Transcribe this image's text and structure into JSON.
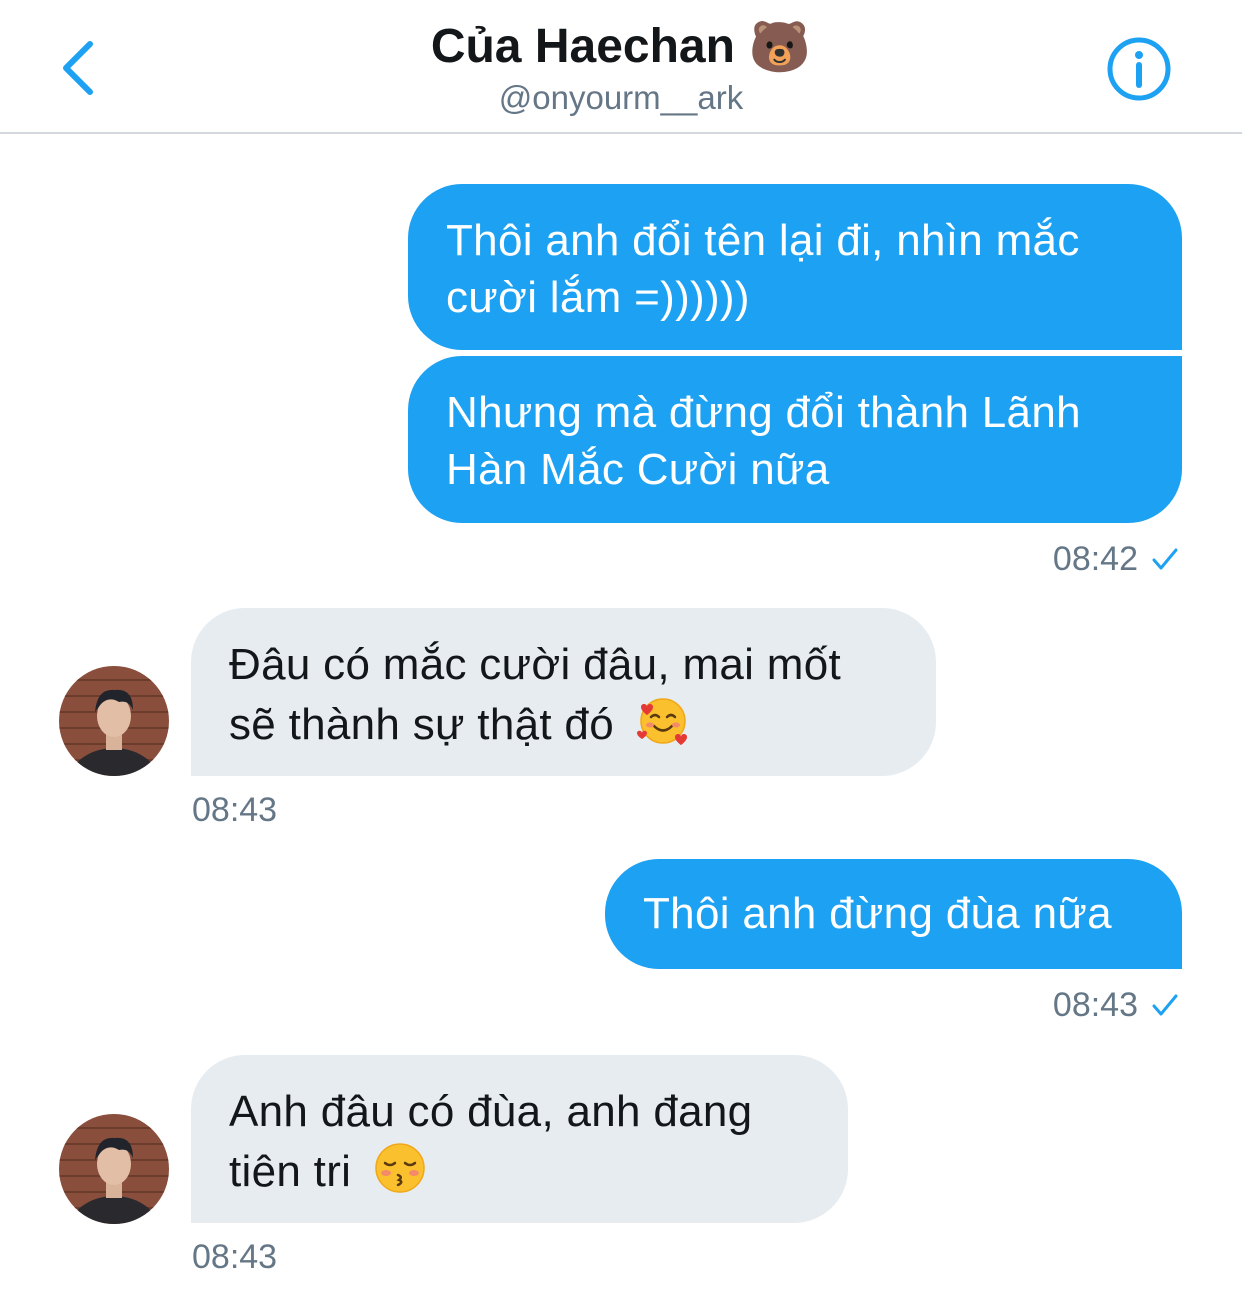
{
  "header": {
    "title": "Của Haechan",
    "title_emoji": "🐻",
    "handle": "@onyourm__ark"
  },
  "messages": [
    {
      "direction": "outgoing",
      "lines": [
        "Thôi anh đổi tên lại đi, nhìn mắc",
        "cười lắm =))))))"
      ]
    },
    {
      "direction": "outgoing",
      "lines": [
        "Nhưng mà đừng đổi thành Lãnh",
        "Hàn Mắc Cười nữa"
      ],
      "time": "08:42"
    },
    {
      "direction": "incoming",
      "lines": [
        "Đâu có mắc cười đâu, mai mốt",
        "sẽ thành sự thật đó"
      ],
      "emoji": "smiling-face-with-hearts",
      "time": "08:43"
    },
    {
      "direction": "outgoing",
      "lines": [
        "Thôi anh đừng đùa nữa"
      ],
      "time": "08:43"
    },
    {
      "direction": "incoming",
      "lines": [
        "Anh đâu có đùa, anh đang",
        "tiên tri"
      ],
      "emoji": "kissing-face-closed-eyes",
      "time": "08:43"
    }
  ],
  "colors": {
    "accent": "#1da1f2",
    "incoming_bubble": "#e6ecf0",
    "text_secondary": "#657786"
  },
  "icons": {
    "back": "chevron-left-icon",
    "info": "info-circle-icon",
    "read": "checkmark-icon"
  }
}
